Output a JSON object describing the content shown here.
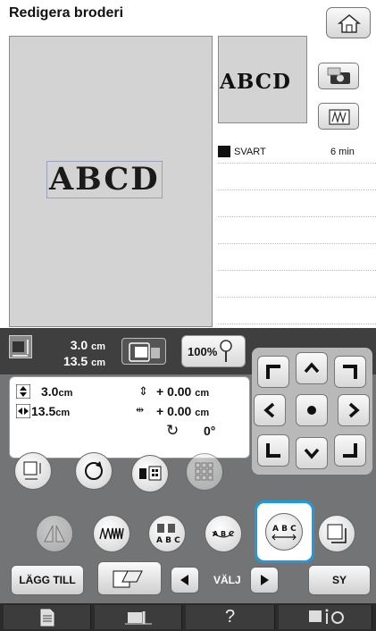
{
  "title": "Redigera broderi",
  "preview": {
    "text": "ABCD"
  },
  "thread": {
    "name": "SVART",
    "time": "6 min"
  },
  "size_header": {
    "h": "3.0",
    "h_unit": "cm",
    "w": "13.5",
    "w_unit": "cm"
  },
  "zoom": "100%",
  "info": {
    "height": "3.0",
    "height_unit": "cm",
    "width": "13.5",
    "width_unit": "cm",
    "dy": "+ 0.00",
    "dy_unit": "cm",
    "dx": "+ 0.00",
    "dx_unit": "cm",
    "angle": "0°"
  },
  "buttons": {
    "add": "LÄGG TILL",
    "select": "VÄLJ",
    "sew": "SY"
  },
  "icons": {
    "home": "home-icon",
    "camera": "camera-icon",
    "density": "density-icon"
  }
}
